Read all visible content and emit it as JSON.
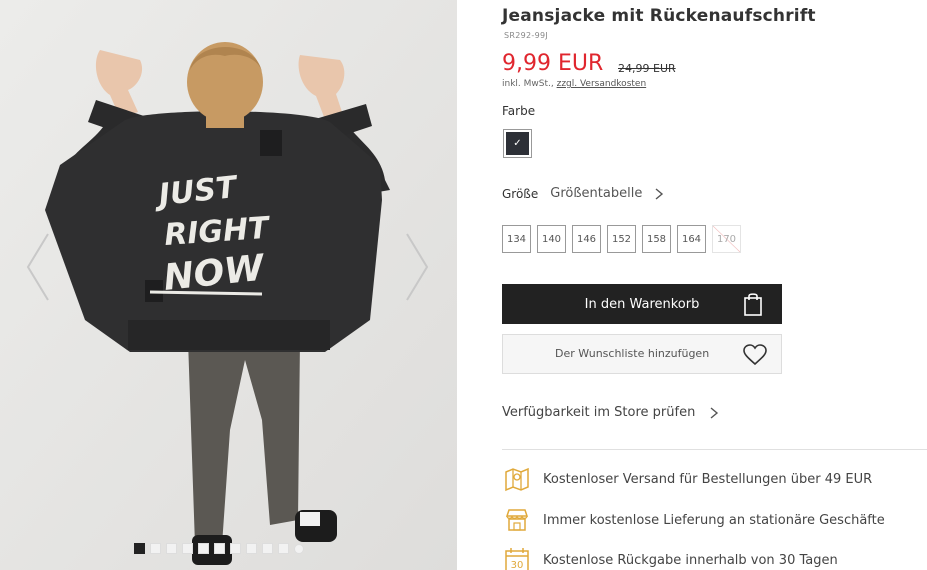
{
  "product": {
    "title": "Jeansjacke mit Rückenaufschrift",
    "sku": "SR292-99J",
    "price": "9,99 EUR",
    "old_price": "24,99 EUR",
    "tax_prefix": "inkl. MwSt., ",
    "tax_link": "zzgl. Versandkosten"
  },
  "color": {
    "label": "Farbe",
    "selected_swatch": "#2d3037",
    "check": "✓"
  },
  "size": {
    "label": "Größe",
    "size_table": "Größentabelle",
    "options": [
      {
        "label": "134",
        "available": true
      },
      {
        "label": "140",
        "available": true
      },
      {
        "label": "146",
        "available": true
      },
      {
        "label": "152",
        "available": true
      },
      {
        "label": "158",
        "available": true
      },
      {
        "label": "164",
        "available": true
      },
      {
        "label": "170",
        "available": false
      }
    ]
  },
  "actions": {
    "add_to_cart": "In den Warenkorb",
    "wishlist": "Der Wunschliste hinzufügen",
    "store_availability": "Verfügbarkeit im Store prüfen"
  },
  "benefits": [
    {
      "icon": "shipping-map-icon",
      "text": "Kostenloser Versand für Bestellungen über 49 EUR"
    },
    {
      "icon": "store-icon",
      "text": "Immer kostenlose Lieferung an stationäre Geschäfte"
    },
    {
      "icon": "calendar-30-icon",
      "text": "Kostenlose Rückgabe innerhalb von 30 Tagen",
      "badge": "30"
    }
  ],
  "gallery": {
    "print_text": [
      "JUST",
      "RIGHT",
      "NOW"
    ],
    "slide_count": 11,
    "active_slide": 1
  },
  "colors": {
    "price_red": "#e0262e",
    "button_dark": "#222222",
    "benefit_gold": "#e0a93b"
  }
}
